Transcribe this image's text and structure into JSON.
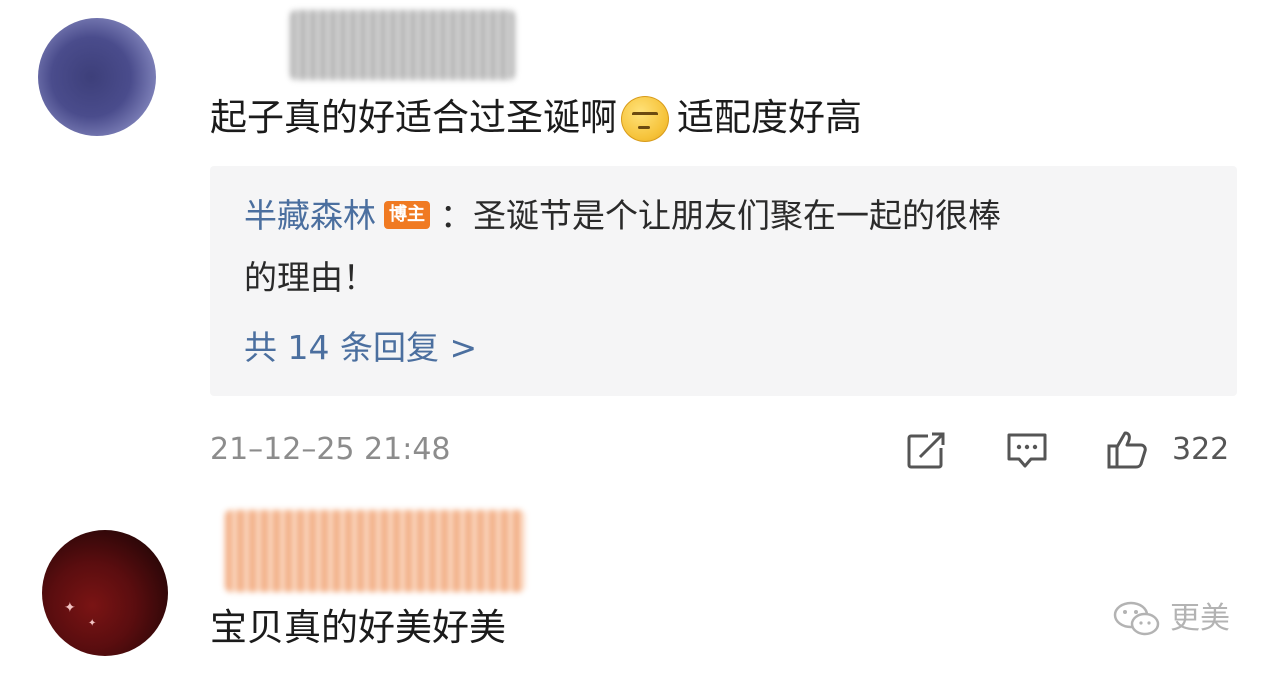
{
  "comment_1": {
    "text_part_1": "起子真的好适合过圣诞啊",
    "emoji": "dizzy-smile-emoji",
    "text_part_2": "适配度好高",
    "reply": {
      "author": "半藏森林",
      "badge": "博主",
      "separator": "：",
      "text_line_1": "圣诞节是个让朋友们聚在一起的很棒",
      "text_line_2": "的理由！",
      "count_label": "共 14 条回复 >"
    },
    "timestamp": "21–12–25 21:48",
    "likes": "322"
  },
  "comment_2": {
    "text": "宝贝真的好美好美"
  },
  "watermark": {
    "icon": "wechat-icon",
    "text": "更美"
  },
  "colors": {
    "link_blue": "#4b6f9f",
    "badge_orange": "#f07a22",
    "reply_background": "#f5f5f6",
    "meta_gray": "#8c8c8c"
  }
}
